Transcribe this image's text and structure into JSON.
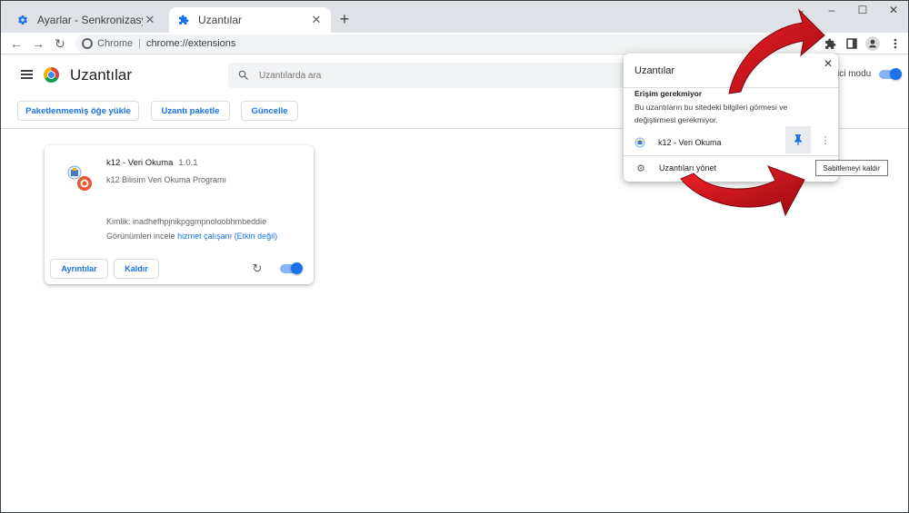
{
  "tabs": [
    {
      "title": "Ayarlar - Senkronizasyon ve Goo",
      "close": "✕"
    },
    {
      "title": "Uzantılar",
      "close": "✕"
    }
  ],
  "new_tab": "+",
  "window_controls": {
    "collapse": "⌄",
    "minimize": "–",
    "maximize": "☐",
    "close": "✕"
  },
  "toolbar": {
    "back": "←",
    "forward": "→",
    "reload": "↻",
    "site_label": "Chrome",
    "separator": "|",
    "url": "chrome://extensions"
  },
  "page": {
    "title": "Uzantılar",
    "search_placeholder": "Uzantılarda ara",
    "dev_mode_label": "ici modu",
    "dev_mode_on": true
  },
  "actions": {
    "load_unpacked": "Paketlenmemiş öğe yükle",
    "pack_extension": "Uzantı paketle",
    "update": "Güncelle"
  },
  "extension": {
    "name": "k12 - Veri Okuma",
    "version": "1.0.1",
    "description": "k12 Bilisim Veri Okuma Programı",
    "id_text": "Kimlik: inadhefhpjnikpggmpnoloobhmbeddie",
    "views_prefix": "Görünümleri incele",
    "views_link": "hizmet çalışanı (Etkin değil)",
    "details_button": "Ayrıntılar",
    "remove_button": "Kaldır",
    "reload": "↻",
    "enabled": true
  },
  "popup": {
    "title": "Uzantılar",
    "close": "✕",
    "section_title": "Erişim gerekmiyor",
    "section_desc": "Bu uzantıların bu sitedeki bilgileri görmesi ve değiştirmesi gerekmiyor.",
    "extension_name": "k12 - Veri Okuma",
    "more": "⋮",
    "manage_label": "Uzantıları yönet",
    "gear": "⚙"
  },
  "tooltip": "Sabitlemeyi kaldır",
  "colors": {
    "accent": "#1a73e8",
    "tabstrip": "#dee1e6",
    "arrow_red": "#d0141c"
  },
  "icons": [
    "settings-gear-icon",
    "puzzle-icon",
    "search-icon",
    "pin-icon",
    "profile-icon",
    "side-panel-icon",
    "kebab-menu-icon"
  ]
}
